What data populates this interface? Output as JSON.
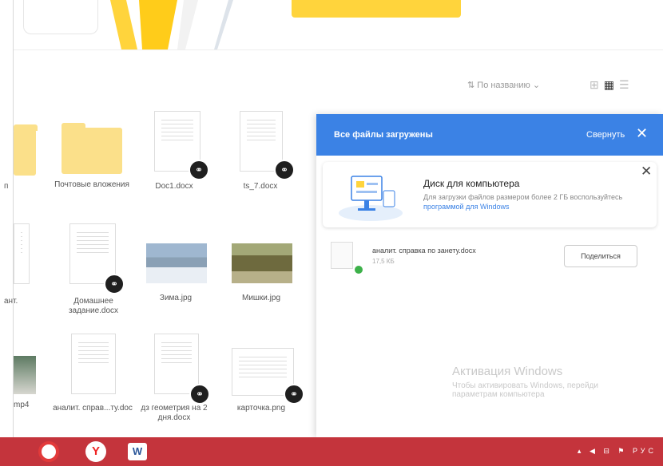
{
  "header": {
    "yellow_button_label": ""
  },
  "toolbar": {
    "sort_label": "По названию",
    "sort_icon": "sort-icon",
    "view_icons": [
      "tiles-icon",
      "grid-icon",
      "list-icon"
    ]
  },
  "files": [
    {
      "name": "Почтовые вложения"
    },
    {
      "name": "Doc1.docx"
    },
    {
      "name": "ts_7.docx"
    },
    {
      "name": "ант."
    },
    {
      "name": "Домашнее задание.docx"
    },
    {
      "name": "Зима.jpg"
    },
    {
      "name": "Мишки.jpg"
    },
    {
      "name": "mp4"
    },
    {
      "name": "аналит. справ...ту.doc"
    },
    {
      "name": "дз геометрия на 2 дня.docx"
    },
    {
      "name": "карточка.png"
    }
  ],
  "panel": {
    "title": "Все файлы загружены",
    "collapse_label": "Свернуть",
    "close_glyph": "✕",
    "promo": {
      "title": "Диск для компьютера",
      "text": "Для загрузки файлов размером более 2 ГБ воспользуйтесь",
      "link": "программой для Windows",
      "close_glyph": "✕"
    },
    "upload": {
      "file_name": "аналит. справка по занету.docx",
      "file_size": "17,5 КБ",
      "share_label": "Поделиться"
    }
  },
  "watermark": {
    "line1": "Активация Windows",
    "line2": "Чтобы активировать Windows, перейди",
    "line3": "параметрам компьютера"
  },
  "taskbar": {
    "yandex_glyph": "Y",
    "word_glyph": "W",
    "tray_text": "▴ ◀ ⊟ ⚑ РУС"
  },
  "colors": {
    "accent_blue": "#3b82e5",
    "brand_yellow": "#ffd43c",
    "folder_yellow": "#fbe08a",
    "taskbar_red": "#c4343c",
    "success_green": "#3db14a"
  }
}
